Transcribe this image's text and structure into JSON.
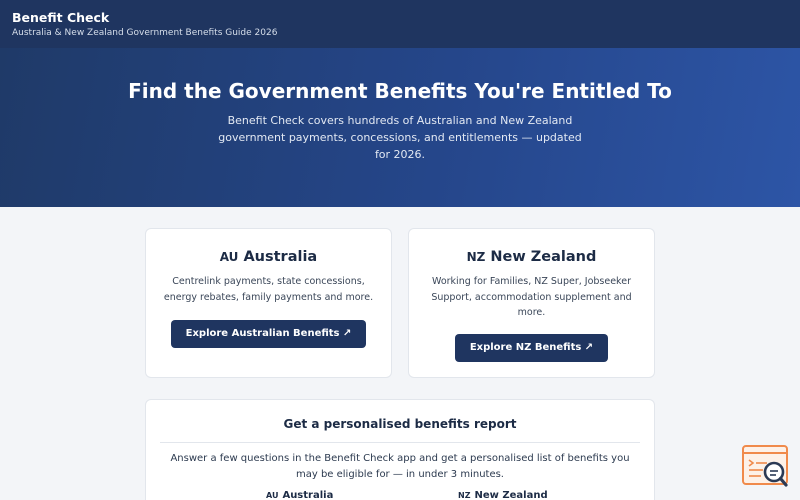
{
  "header": {
    "brand": "Benefit Check",
    "tagline": "Australia & New Zealand Government Benefits Guide 2026"
  },
  "hero": {
    "title": "Find the Government Benefits You're Entitled To",
    "subtitle": "Benefit Check covers hundreds of Australian and New Zealand government payments, concessions, and entitlements — updated for 2026."
  },
  "cards": {
    "au": {
      "flag": "AU",
      "title": "Australia",
      "description": "Centrelink payments, state concessions, energy rebates, family payments and more.",
      "button": "Explore Australian Benefits ↗"
    },
    "nz": {
      "flag": "NZ",
      "title": "New Zealand",
      "description": "Working for Families, NZ Super, Jobseeker Support, accommodation supplement and more.",
      "button": "Explore NZ Benefits ↗"
    }
  },
  "report": {
    "title": "Get a personalised benefits report",
    "description": "Answer a few questions in the Benefit Check app and get a personalised list of benefits you may be eligible for — in under 3 minutes.",
    "links": {
      "au_flag": "AU",
      "au": "Australia",
      "nz_flag": "NZ",
      "nz": "New Zealand"
    }
  },
  "helper": {
    "icon": "search-document-icon",
    "colors": {
      "accent": "#f08a4b",
      "ink": "#2b3a55"
    }
  }
}
